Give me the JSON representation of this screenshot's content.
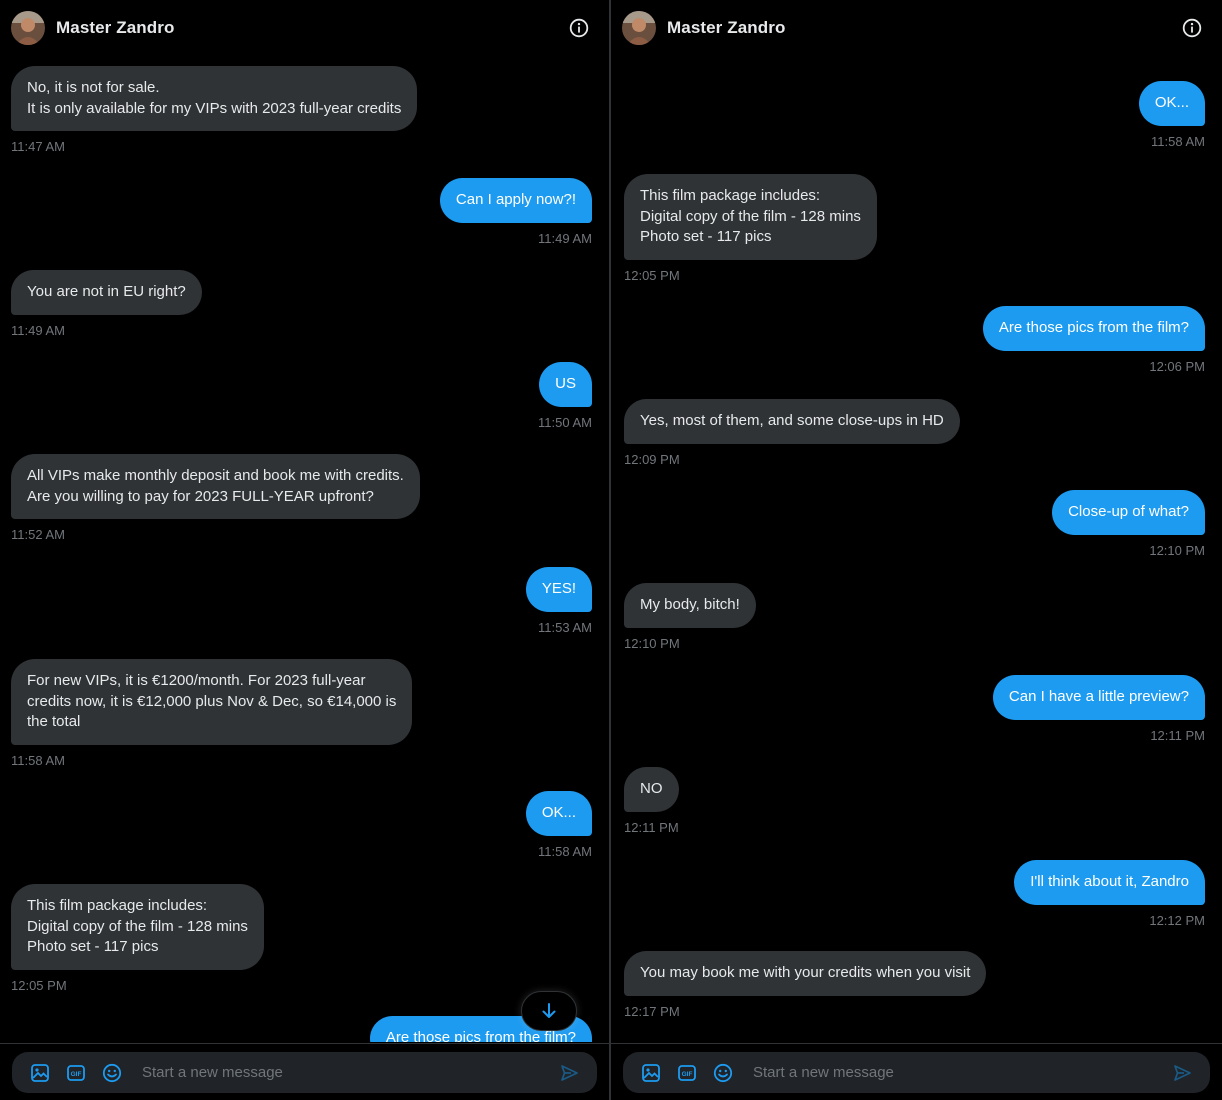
{
  "contact": {
    "name": "Master Zandro"
  },
  "composer": {
    "placeholder": "Start a new message"
  },
  "colors": {
    "accent": "#1d9bf0",
    "incoming_bubble": "#2f3336",
    "background": "#000000",
    "timestamp": "#71767b"
  },
  "icons": {
    "info": "info-circle-icon",
    "media": "image-icon",
    "gif": "gif-icon",
    "emoji": "emoji-icon",
    "send": "send-icon",
    "scroll": "arrow-down-icon"
  },
  "left_panel": {
    "messages": [
      {
        "dir": "in",
        "text": "No, it is not for sale.\nIt is only available for my VIPs with 2023 full-year credits",
        "time": "11:47 AM"
      },
      {
        "dir": "out",
        "text": "Can I apply now?!",
        "time": "11:49 AM"
      },
      {
        "dir": "in",
        "text": "You are not in EU right?",
        "time": "11:49 AM"
      },
      {
        "dir": "out",
        "text": "US",
        "time": "11:50 AM"
      },
      {
        "dir": "in",
        "text": "All VIPs make monthly deposit and book me with credits.\nAre you willing to pay for 2023 FULL-YEAR upfront?",
        "time": "11:52 AM"
      },
      {
        "dir": "out",
        "text": "YES!",
        "time": "11:53 AM"
      },
      {
        "dir": "in",
        "text": "For new VIPs, it is €1200/month. For 2023 full-year\ncredits now, it is €12,000 plus Nov & Dec, so €14,000 is\nthe total",
        "time": "11:58 AM"
      },
      {
        "dir": "out",
        "text": "OK...",
        "time": "11:58 AM"
      },
      {
        "dir": "in",
        "text": "This film package includes:\nDigital copy of the film - 128 mins\nPhoto set - 117 pics",
        "time": "12:05 PM"
      },
      {
        "dir": "out",
        "text": "Are those pics from the film?",
        "time": ""
      }
    ]
  },
  "right_panel": {
    "messages": [
      {
        "dir": "out",
        "text": "OK...",
        "time": "11:58 AM"
      },
      {
        "dir": "in",
        "text": "This film package includes:\nDigital copy of the film - 128 mins\nPhoto set - 117 pics",
        "time": "12:05 PM"
      },
      {
        "dir": "out",
        "text": "Are those pics from the film?",
        "time": "12:06 PM"
      },
      {
        "dir": "in",
        "text": "Yes, most of them, and some close-ups in HD",
        "time": "12:09 PM"
      },
      {
        "dir": "out",
        "text": "Close-up of what?",
        "time": "12:10 PM"
      },
      {
        "dir": "in",
        "text": "My body, bitch!",
        "time": "12:10 PM"
      },
      {
        "dir": "out",
        "text": "Can I have a little preview?",
        "time": "12:11 PM"
      },
      {
        "dir": "in",
        "text": "NO",
        "time": "12:11 PM"
      },
      {
        "dir": "out",
        "text": "I'll think about it, Zandro",
        "time": "12:12 PM"
      },
      {
        "dir": "in",
        "text": "You may book me with your credits when you visit",
        "time": "12:17 PM"
      }
    ]
  }
}
